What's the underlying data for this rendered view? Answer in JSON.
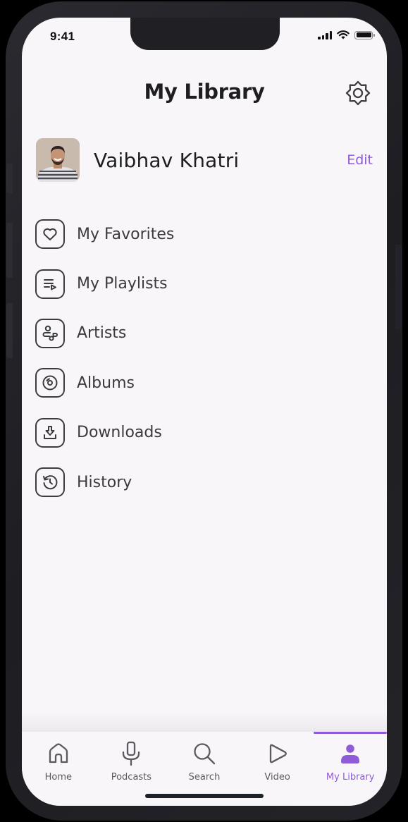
{
  "status_bar": {
    "time": "9:41",
    "signal_icon": "cellular-signal-icon",
    "wifi_icon": "wifi-icon",
    "battery_icon": "battery-icon"
  },
  "header": {
    "title": "My Library",
    "settings_icon": "gear-icon"
  },
  "profile": {
    "name": "Vaibhav Khatri",
    "edit_label": "Edit",
    "avatar": "profile-photo"
  },
  "menu": {
    "items": [
      {
        "label": "My Favorites",
        "icon": "heart-icon"
      },
      {
        "label": "My Playlists",
        "icon": "playlist-icon"
      },
      {
        "label": "Artists",
        "icon": "artist-icon"
      },
      {
        "label": "Albums",
        "icon": "album-disc-icon"
      },
      {
        "label": "Downloads",
        "icon": "download-icon"
      },
      {
        "label": "History",
        "icon": "history-icon"
      }
    ]
  },
  "tabbar": {
    "active": "My Library",
    "tabs": [
      {
        "label": "Home",
        "icon": "home-icon"
      },
      {
        "label": "Podcasts",
        "icon": "microphone-icon"
      },
      {
        "label": "Search",
        "icon": "search-icon"
      },
      {
        "label": "Video",
        "icon": "play-icon"
      },
      {
        "label": "My Library",
        "icon": "user-icon"
      }
    ]
  },
  "colors": {
    "accent": "#8f5bd8",
    "text_primary": "#1e1e22",
    "text_secondary": "#3a3a3f",
    "background": "#f8f6f9",
    "frame": "#1f1f24"
  }
}
